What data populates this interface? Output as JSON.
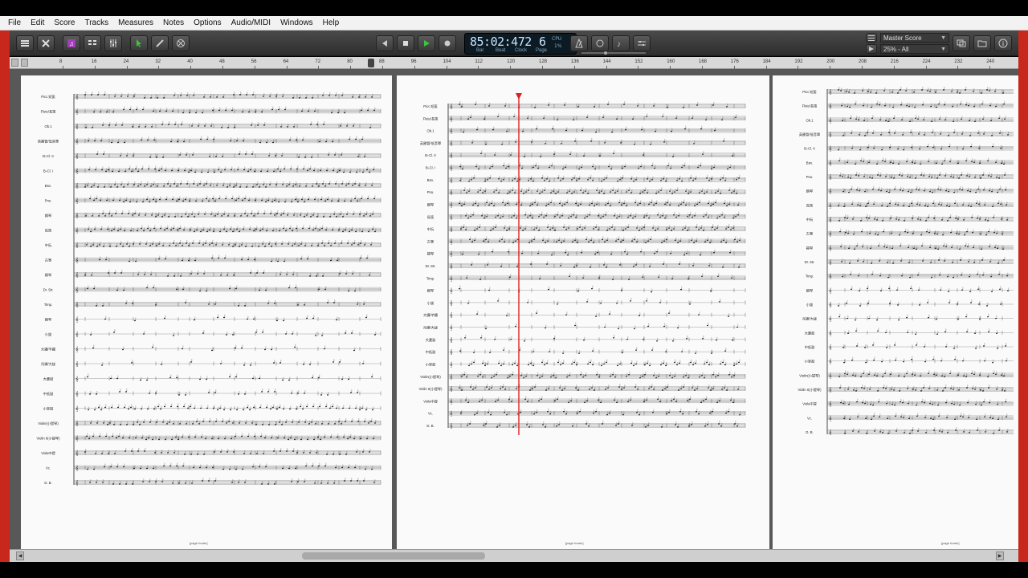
{
  "menu": [
    "File",
    "Edit",
    "Score",
    "Tracks",
    "Measures",
    "Notes",
    "Options",
    "Audio/MIDI",
    "Windows",
    "Help"
  ],
  "transport": {
    "counter": "85:02:472",
    "page": "6",
    "labels": [
      "Bar",
      "Beat",
      "Clock",
      "Page"
    ],
    "cpu_label": "CPU",
    "cpu_value": "1%"
  },
  "score_select": "Master Score",
  "zoom_select": "25% - All",
  "ruler_ticks": [
    "8",
    "16",
    "24",
    "32",
    "40",
    "48",
    "56",
    "64",
    "72",
    "80",
    "88",
    "96",
    "104",
    "112",
    "120",
    "128",
    "136",
    "144",
    "152",
    "160",
    "168",
    "176",
    "184",
    "192",
    "200",
    "208",
    "216",
    "224",
    "232",
    "240"
  ],
  "page1_instruments": [
    "Picc.短笛",
    "Flute/長笛",
    "Ob.1",
    "英國管/低音單",
    "B♭Cl. II",
    "B♭Cl. I",
    "Bsn.",
    "Pno.",
    "鋼琴",
    "長笛",
    "中阮",
    "古箏",
    "揚琴",
    "Dr. Str.",
    "Timp.",
    "鋼琴",
    "小鈸",
    "大鑼/芊鑼",
    "吊鑔/大鈸",
    "大蘆鼓",
    "中低鼓",
    "小堂鼓",
    "Violin(小提琴)",
    "Violin II(小提琴)",
    "Viola中提",
    "Vc.",
    "D. B."
  ],
  "page2_instruments": [
    "Picc.短笛",
    "Flute/長笛",
    "Ob.1",
    "英國管/低音單",
    "B♭Cl. II",
    "B♭Cl. I",
    "Bsn.",
    "Pno.",
    "鋼琴",
    "長笛",
    "中阮",
    "古箏",
    "揚琴",
    "Dr. Str.",
    "Timp.",
    "鋼琴",
    "小鈸",
    "大鑼/芊鑼",
    "吊鑔/大鈸",
    "大蘆鼓",
    "中低鼓",
    "小堂鼓",
    "Violin(小提琴)",
    "Violin II(小提琴)",
    "Viola中提",
    "Vc.",
    "D. B."
  ],
  "page3_instruments": [
    "Picc.短笛",
    "Flute/長笛",
    "Ob.1",
    "英國管/低音單",
    "B♭Cl. II",
    "Bsn.",
    "Pno.",
    "鋼琴",
    "長笛",
    "中阮",
    "古箏",
    "揚琴",
    "Dr. Str.",
    "Timp.",
    "鋼琴",
    "小鈸",
    "吊鑔/大鈸",
    "大蘆鼓",
    "中低鼓",
    "小堂鼓",
    "Violin(小提琴)",
    "Violin II(小提琴)",
    "Viola中提",
    "Vc.",
    "D. B."
  ],
  "page_footer": "[page footer]",
  "colors": {
    "accent_red": "#c8281c",
    "playhead": "#e02020",
    "counter_text": "#c9e4ff"
  },
  "icons": [
    "menu-icon",
    "tools-icon",
    "note-icon",
    "list-icon",
    "mixer-icon",
    "select-arrow-icon",
    "pencil-icon",
    "erase-icon",
    "rewind-icon",
    "stop-icon",
    "play-icon",
    "record-icon",
    "metronome-icon",
    "loop-icon",
    "notes-icon",
    "mixer-fader-icon",
    "windows-icon",
    "folder-icon",
    "info-icon"
  ]
}
